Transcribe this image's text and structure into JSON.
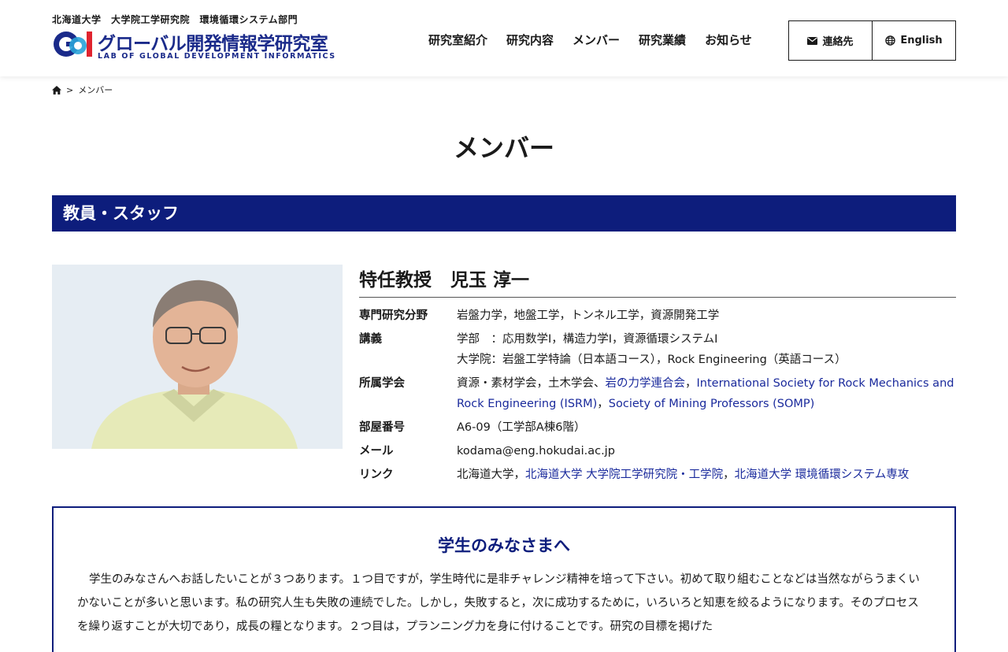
{
  "header": {
    "university_line": "北海道大学　大学院工学研究院　環境循環システム部門",
    "logo_title": "グローバル開発情報学研究室",
    "logo_subtitle": "LAB OF GLOBAL DEVELOPMENT INFORMATICS",
    "nav": [
      "研究室紹介",
      "研究内容",
      "メンバー",
      "研究業績",
      "お知らせ"
    ],
    "contact_label": "連絡先",
    "english_label": "English"
  },
  "breadcrumb": {
    "separator": ">",
    "current": "メンバー"
  },
  "page_title": "メンバー",
  "section_title": "教員・スタッフ",
  "profile": {
    "position": "特任教授",
    "name": "児玉 淳一",
    "fields": {
      "label": "専門研究分野",
      "value": "岩盤力学，地盤工学，トンネル工学，資源開発工学"
    },
    "lectures": {
      "label": "講義",
      "line1": "学部　：応用数学I，構造力学I，資源循環システムI",
      "line2": "大学院：岩盤工学特論（日本語コース），Rock Engineering（英語コース）"
    },
    "societies": {
      "label": "所属学会",
      "text1": "資源・素材学会，土木学会、",
      "link1": "岩の力学連合会",
      "sep1": "，",
      "link2": "International Society for Rock Mechanics and Rock Engineering (ISRM)",
      "sep2": "，",
      "link3": "Society of Mining Professors (SOMP)"
    },
    "room": {
      "label": "部屋番号",
      "value": "A6-09（工学部A棟6階）"
    },
    "email": {
      "label": "メール",
      "value": "kodama@eng.hokudai.ac.jp"
    },
    "links": {
      "label": "リンク",
      "text1": "北海道大学，",
      "link1": "北海道大学 大学院工学研究院・工学院",
      "sep1": "，",
      "link2": "北海道大学 環境循環システム専攻"
    }
  },
  "students": {
    "title": "学生のみなさまへ",
    "text": "学生のみなさんへお話したいことが３つあります。１つ目ですが，学生時代に是非チャレンジ精神を培って下さい。初めて取り組むことなどは当然ながらうまくいかないことが多いと思います。私の研究人生も失敗の連続でした。しかし，失敗すると，次に成功するために，いろいろと知恵を絞るようになります。そのプロセスを繰り返すことが大切であり，成長の糧となります。２つ目は，プランニング力を身に付けることです。研究の目標を掲げた"
  },
  "colors": {
    "brand_navy": "#0d1d7c",
    "link_blue": "#1a2a9c",
    "logo_red": "#e0242f",
    "logo_cyan": "#2aa3d8"
  }
}
